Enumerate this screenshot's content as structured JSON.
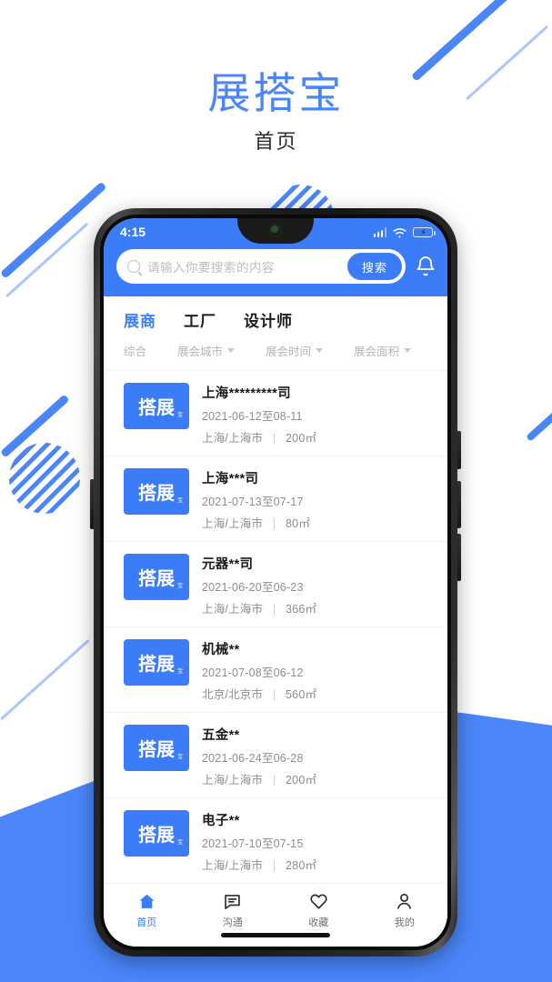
{
  "page": {
    "app_title": "展搭宝",
    "subtitle": "首页",
    "accent_color": "#4a86fa",
    "header_blue": "#3b7cf9"
  },
  "status_bar": {
    "time": "4:15",
    "signal_icon": "signal-bars-icon",
    "wifi_icon": "wifi-icon",
    "battery_icon": "battery-charging-icon"
  },
  "search": {
    "placeholder": "请输入你要搜索的内容",
    "value": "",
    "button_label": "搜索",
    "search_icon": "search-icon",
    "bell_icon": "bell-icon"
  },
  "tabs": [
    {
      "label": "展商",
      "active": true
    },
    {
      "label": "工厂",
      "active": false
    },
    {
      "label": "设计师",
      "active": false
    }
  ],
  "filters": [
    {
      "label": "综合",
      "has_caret": false
    },
    {
      "label": "展会城市",
      "has_caret": true
    },
    {
      "label": "展会时间",
      "has_caret": true
    },
    {
      "label": "展会面积",
      "has_caret": true
    }
  ],
  "logo": {
    "text": "搭展",
    "mark": "宝"
  },
  "list": [
    {
      "title": "上海*********司",
      "date": "2021-06-12至08-11",
      "location": "上海/上海市",
      "area": "200㎡"
    },
    {
      "title": "上海***司",
      "date": "2021-07-13至07-17",
      "location": "上海/上海市",
      "area": "80㎡"
    },
    {
      "title": "元器**司",
      "date": "2021-06-20至06-23",
      "location": "上海/上海市",
      "area": "366㎡"
    },
    {
      "title": "机械**",
      "date": "2021-07-08至06-12",
      "location": "北京/北京市",
      "area": "560㎡"
    },
    {
      "title": "五金**",
      "date": "2021-06-24至06-28",
      "location": "上海/上海市",
      "area": "200㎡"
    },
    {
      "title": "电子**",
      "date": "2021-07-10至07-15",
      "location": "上海/上海市",
      "area": "280㎡"
    }
  ],
  "separator": "|",
  "bottom_nav": [
    {
      "label": "首页",
      "icon": "home-icon",
      "active": true
    },
    {
      "label": "沟通",
      "icon": "chat-icon",
      "active": false
    },
    {
      "label": "收藏",
      "icon": "heart-icon",
      "active": false
    },
    {
      "label": "我的",
      "icon": "person-icon",
      "active": false
    }
  ]
}
